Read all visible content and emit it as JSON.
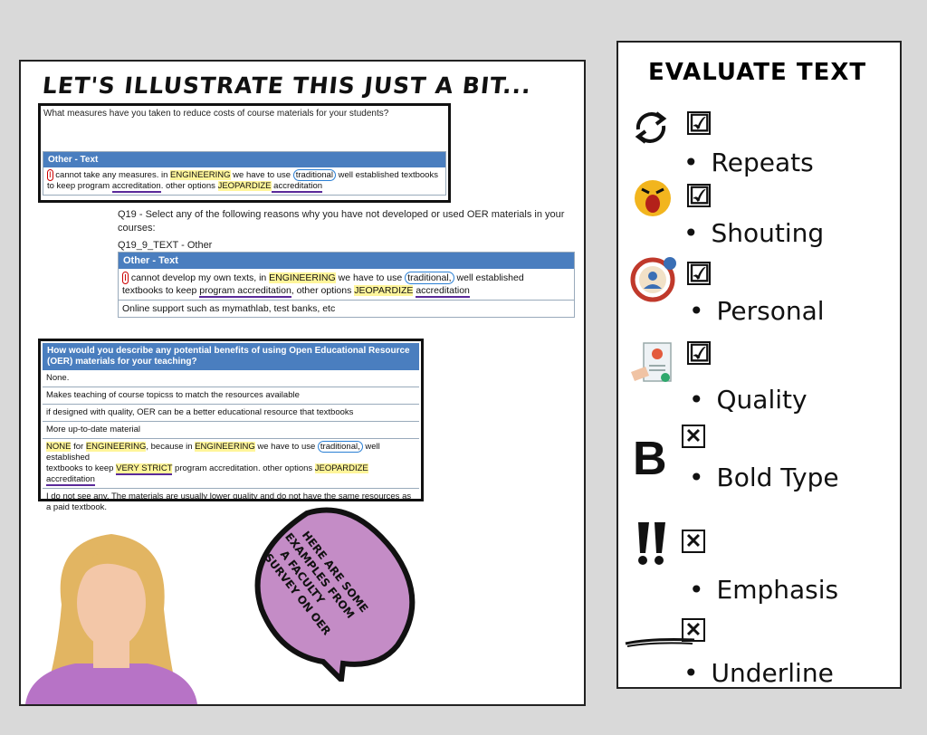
{
  "left": {
    "heading": "LET'S ILLUSTRATE THIS JUST A BIT...",
    "box1": {
      "question": "What measures have you taken to reduce costs of course materials for your students?",
      "header": "Other - Text",
      "line1": {
        "a": "I",
        "b": " cannot take any measures. in ",
        "c": "ENGINEERING",
        "d": " we have to use ",
        "e": "traditional",
        "f": " well established textbooks"
      },
      "line2": {
        "a": "to keep program ",
        "b": "accreditation",
        "c": ". other options ",
        "d": "JEOPARDIZE",
        "e": " accreditation"
      }
    },
    "q19": {
      "question": "Q19 - Select any of the following reasons why you have not developed or used OER materials in your courses:",
      "sub": "Q19_9_TEXT - Other",
      "header": "Other - Text",
      "line1": {
        "a": "I",
        "b": " cannot develop my own texts, in ",
        "c": "ENGINEERING",
        "d": " we have to use ",
        "e": "traditional,",
        "f": " well established"
      },
      "line2": {
        "a": "textbooks to keep ",
        "b": "program accreditation",
        "c": ", other options ",
        "d": "JEOPARDIZE",
        "e": " ",
        "f": "accreditation"
      },
      "row2": "Online support such as mymathlab, test banks, etc"
    },
    "box2": {
      "header": "How would you describe any potential benefits of using Open Educational Resource (OER) materials for your teaching?",
      "rows": [
        "None.",
        "Makes teaching of course topicss to match the resources available",
        "if designed with quality, OER can be a better educational resource that textbooks",
        "More up-to-date material"
      ],
      "row5_line1": {
        "a": "NONE",
        "b": " for ",
        "c": "ENGINEERING",
        "d": ", because in ",
        "e": "ENGINEERING",
        "f": " we have to use ",
        "g": "traditional,",
        "h": " well established"
      },
      "row5_line2": {
        "a": "textbooks to keep ",
        "b": "VERY STRICT",
        "c": " program accreditation. other options ",
        "d": "JEOPARDIZE",
        "e": " accreditation"
      },
      "row6": "I do not see any. The materials are usually lower quality and do not have the same resources as a paid textbook."
    },
    "bubble_lines": [
      "HERE ARE SOME",
      "EXAMPLES FROM",
      "A FACULTY",
      "SURVEY ON OER"
    ]
  },
  "right": {
    "title": "EVALUATE TEXT",
    "checked_mark": "☑",
    "x_mark": "✕",
    "bold_glyph": "B",
    "items": [
      {
        "label": "Repeats",
        "icon": "repeat-icon",
        "state": "checked"
      },
      {
        "label": "Shouting",
        "icon": "shouting-face-icon",
        "state": "checked"
      },
      {
        "label": "Personal",
        "icon": "personal-settings-icon",
        "state": "checked"
      },
      {
        "label": "Quality",
        "icon": "certificate-icon",
        "state": "checked"
      },
      {
        "label": "Bold Type",
        "icon": "bold-b-icon",
        "state": "x"
      },
      {
        "label": "Emphasis",
        "icon": "double-exclamation-icon",
        "state": "x"
      },
      {
        "label": "Underline",
        "icon": "underline-stroke-icon",
        "state": "x"
      }
    ]
  }
}
